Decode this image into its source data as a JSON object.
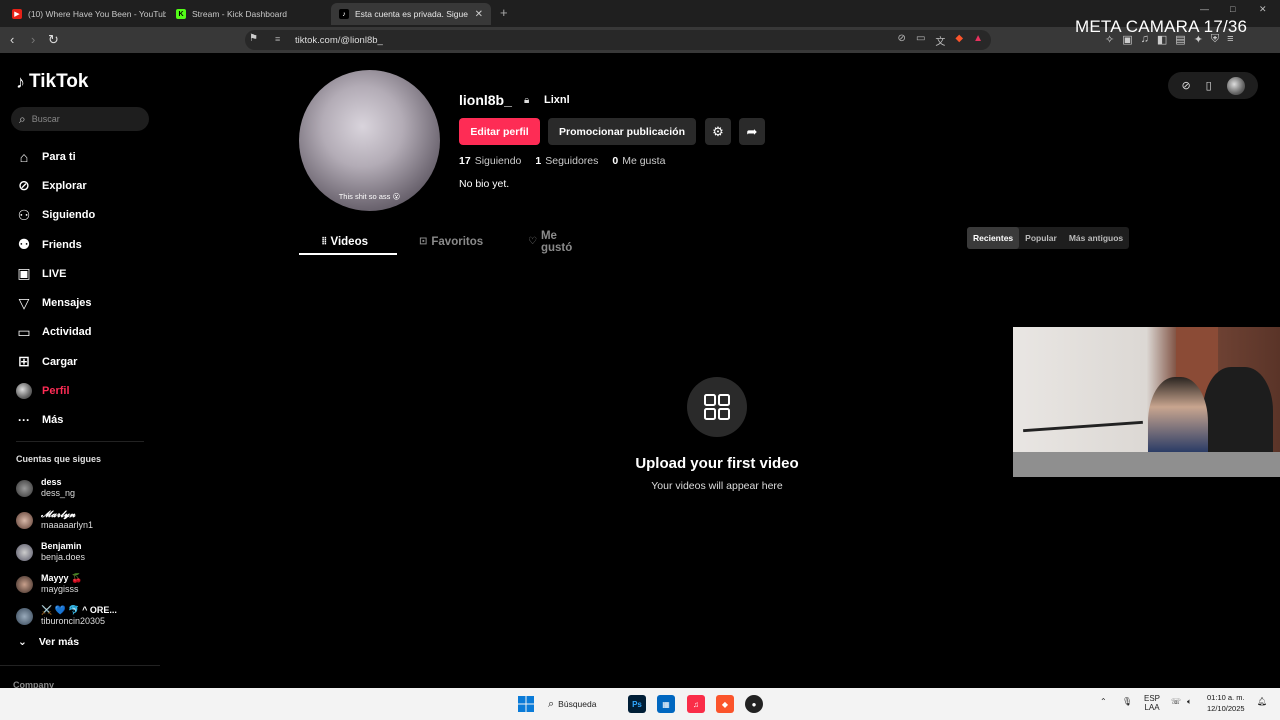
{
  "browser": {
    "tabs": [
      {
        "label": "(10) Where Have You Been - YouTube",
        "active": false
      },
      {
        "label": "Stream - Kick Dashboard",
        "active": false
      },
      {
        "label": "Esta cuenta es privada. Sigue es",
        "active": true
      }
    ],
    "url": "tiktok.com/@lionl8b_"
  },
  "overlay": {
    "label": "META CAMARA 17/36"
  },
  "sidebar": {
    "logo": "TikTok",
    "search_placeholder": "Buscar",
    "menu": [
      {
        "label": "Para ti",
        "icon": "home-icon"
      },
      {
        "label": "Explorar",
        "icon": "compass-icon"
      },
      {
        "label": "Siguiendo",
        "icon": "following-icon"
      },
      {
        "label": "Friends",
        "icon": "friends-icon"
      },
      {
        "label": "LIVE",
        "icon": "live-icon"
      },
      {
        "label": "Mensajes",
        "icon": "messages-icon"
      },
      {
        "label": "Actividad",
        "icon": "activity-icon"
      },
      {
        "label": "Cargar",
        "icon": "upload-icon"
      },
      {
        "label": "Perfil",
        "icon": "profile-avatar-icon"
      },
      {
        "label": "Más",
        "icon": "more-icon"
      }
    ],
    "following_title": "Cuentas que sigues",
    "following": [
      {
        "name": "dess",
        "handle": "dess_ng"
      },
      {
        "name": "𝓜𝓪𝓻𝓵𝔂𝓷",
        "handle": "maaaaarlyn1"
      },
      {
        "name": "Benjamin",
        "handle": "benja.does"
      },
      {
        "name": "Mayyy 🍒",
        "handle": "maygisss"
      },
      {
        "name": "⚔️ 💙 🐬 ^ ORE...",
        "handle": "tiburoncin20305"
      }
    ],
    "see_more": "Ver más",
    "company": "Company"
  },
  "profile": {
    "avatar_caption": "This shit so ass 😮",
    "username": "lionl8b_",
    "nickname": "Lixnl",
    "edit_button": "Editar perfil",
    "promote_button": "Promocionar publicación",
    "stats": {
      "following_count": "17",
      "following_label": "Siguiendo",
      "followers_count": "1",
      "followers_label": "Seguidores",
      "likes_count": "0",
      "likes_label": "Me gusta"
    },
    "bio": "No bio yet.",
    "tabs": [
      "Videos",
      "Favoritos",
      "Me gustó"
    ],
    "sort": [
      "Recientes",
      "Popular",
      "Más antiguos"
    ],
    "empty_title": "Upload your first video",
    "empty_subtitle": "Your videos will appear here"
  },
  "taskbar": {
    "search_label": "Búsqueda",
    "lang_1": "ESP",
    "lang_2": "LAA",
    "time": "01:10 a. m.",
    "date": "12/10/2025"
  },
  "colors": {
    "accent": "#fe2c55",
    "background": "#000000",
    "button": "#2a2a2a"
  }
}
